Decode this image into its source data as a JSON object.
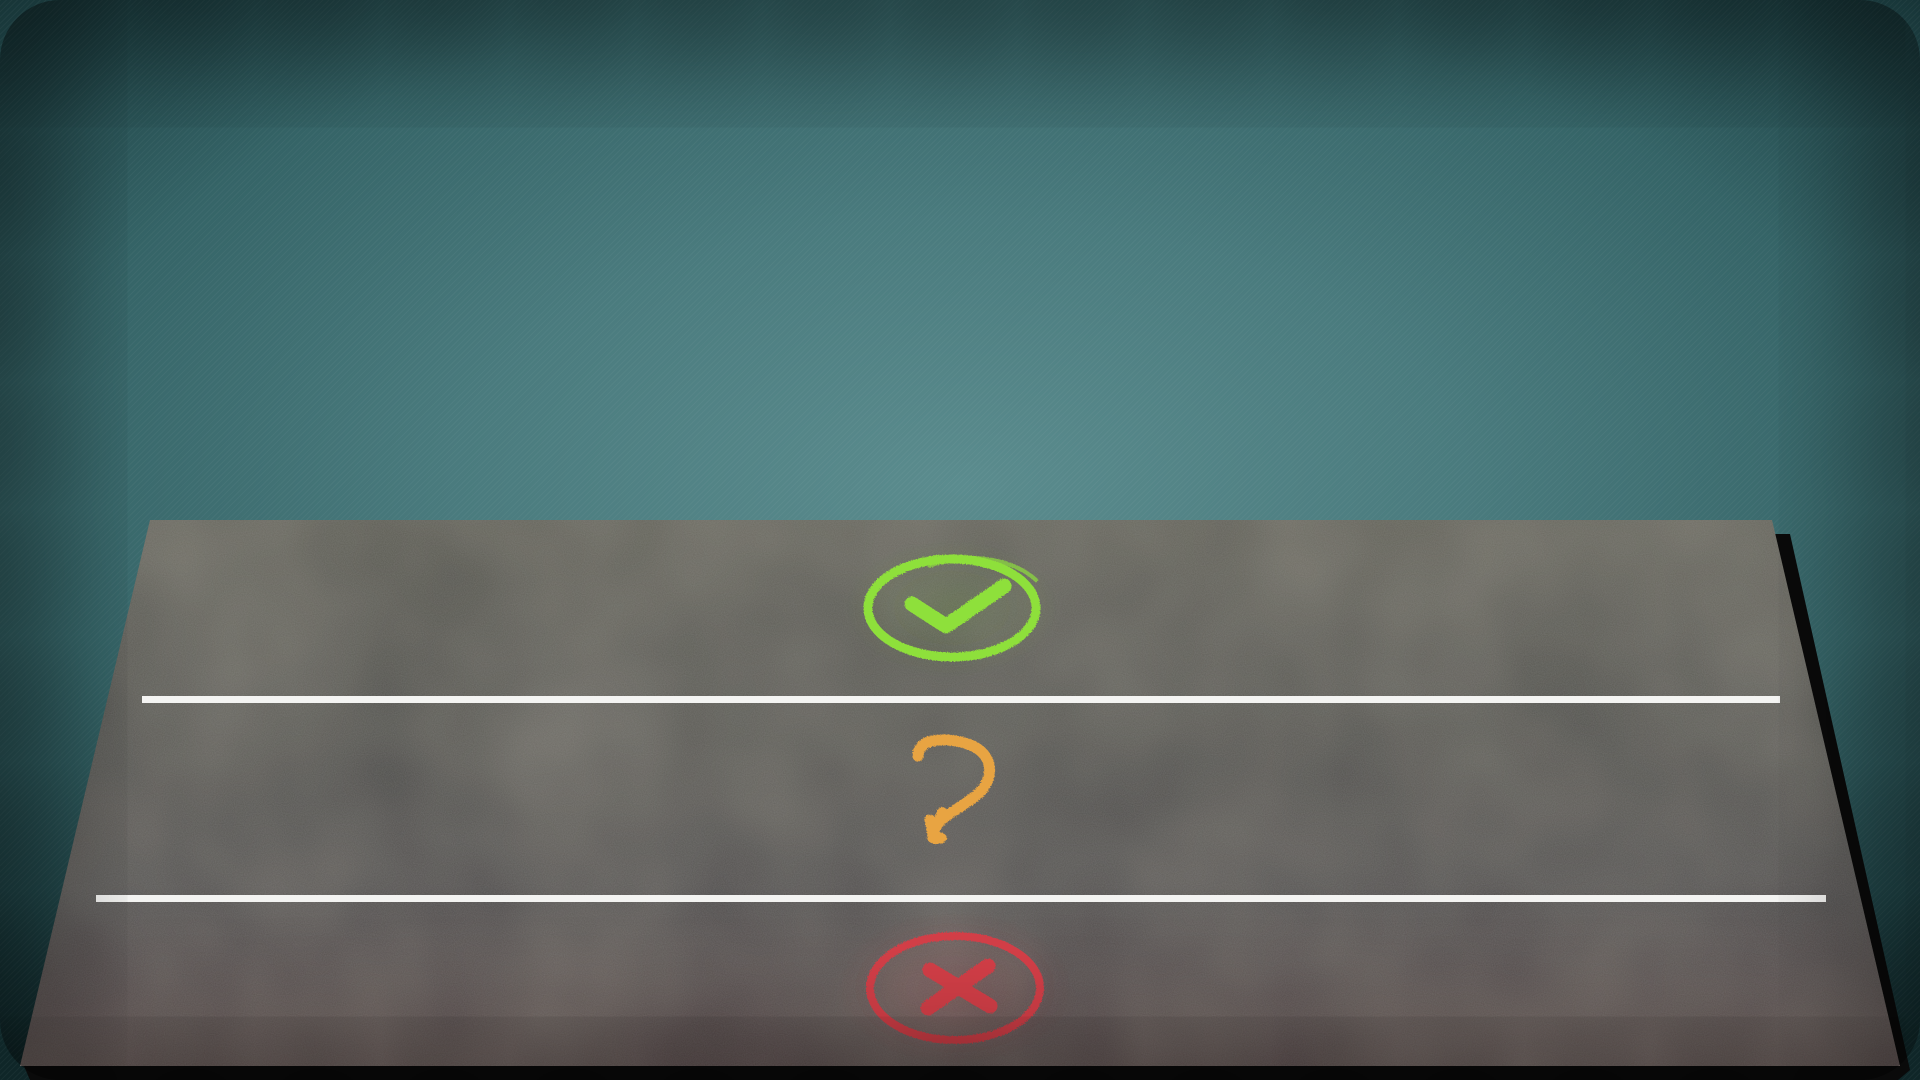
{
  "scene": {
    "background_color": "#4e8285",
    "board_color": "#4a4a46",
    "divider_color": "#ffffff"
  },
  "zones": [
    {
      "id": "yes",
      "icon": "check-circle-icon",
      "color": "#8ee03a"
    },
    {
      "id": "maybe",
      "icon": "question-mark-icon",
      "color": "#e8a443"
    },
    {
      "id": "no",
      "icon": "x-circle-icon",
      "color": "#d8404a"
    }
  ]
}
